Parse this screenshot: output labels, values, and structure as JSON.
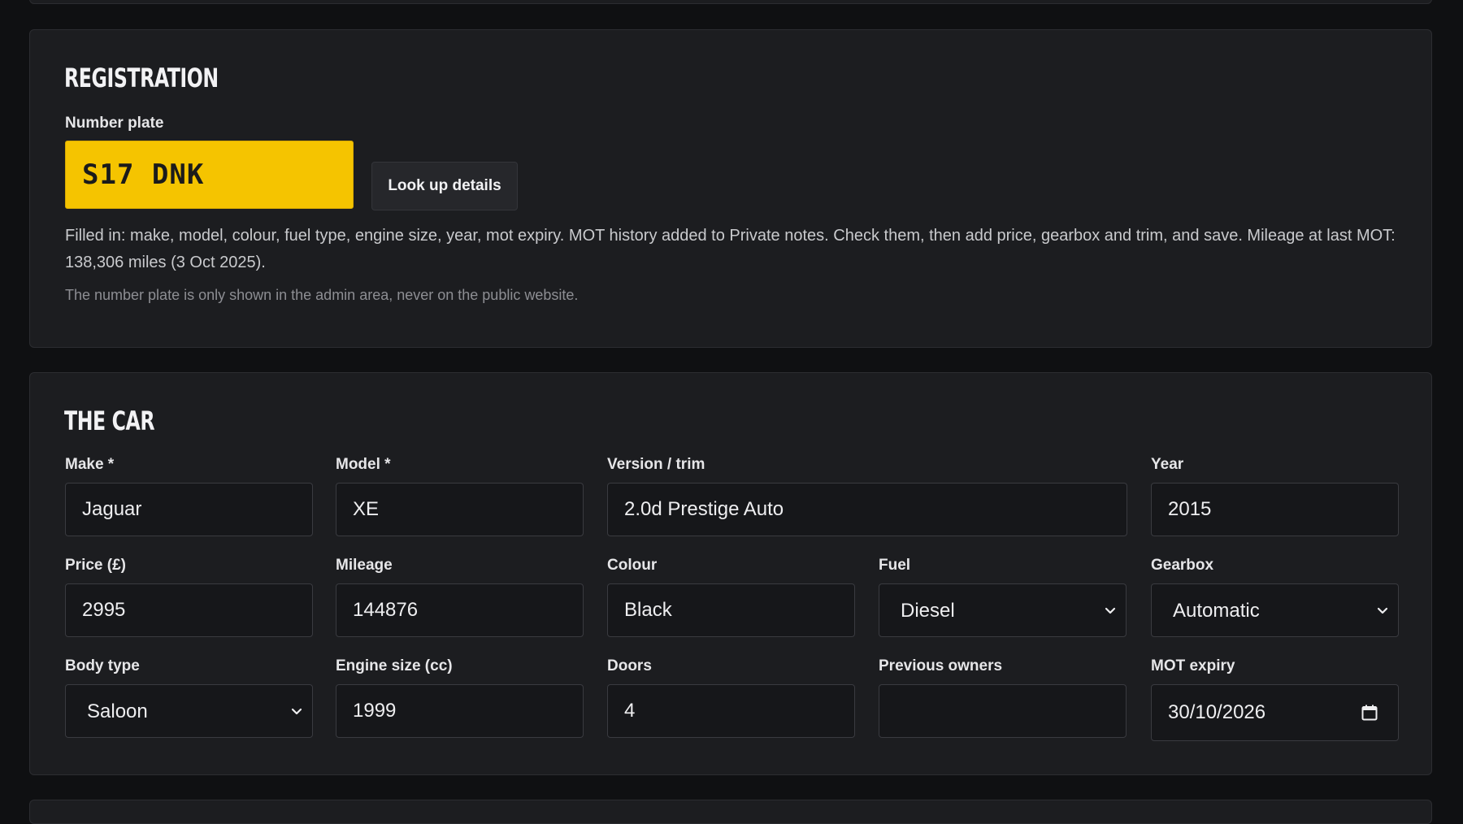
{
  "registration": {
    "title": "REGISTRATION",
    "plate_label": "Number plate",
    "plate_value": "S17 DNK",
    "lookup_button": "Look up details",
    "info_text": "Filled in: make, model, colour, fuel type, engine size, year, mot expiry. MOT history added to Private notes. Check them, then add price, gearbox and trim, and save. Mileage at last MOT: 138,306 miles (3 Oct 2025).",
    "hint_text": "The number plate is only shown in the admin area, never on the public website."
  },
  "car": {
    "title": "THE CAR",
    "make": {
      "label": "Make *",
      "value": "Jaguar"
    },
    "model": {
      "label": "Model *",
      "value": "XE"
    },
    "version": {
      "label": "Version / trim",
      "value": "2.0d Prestige Auto"
    },
    "year": {
      "label": "Year",
      "value": "2015"
    },
    "price": {
      "label": "Price (£)",
      "value": "2995"
    },
    "mileage": {
      "label": "Mileage",
      "value": "144876"
    },
    "colour": {
      "label": "Colour",
      "value": "Black"
    },
    "fuel": {
      "label": "Fuel",
      "value": "Diesel"
    },
    "gearbox": {
      "label": "Gearbox",
      "value": "Automatic"
    },
    "body_type": {
      "label": "Body type",
      "value": "Saloon"
    },
    "engine_size": {
      "label": "Engine size (cc)",
      "value": "1999"
    },
    "doors": {
      "label": "Doors",
      "value": "4"
    },
    "previous_owners": {
      "label": "Previous owners",
      "value": ""
    },
    "mot_expiry": {
      "label": "MOT expiry",
      "value": "30/10/2026"
    }
  },
  "icons": {
    "select_chevron": "chevron-down-icon",
    "date_picker": "calendar-icon"
  },
  "colors": {
    "plate_yellow": "#f5c400",
    "background": "#0f1012",
    "card": "#1c1d20"
  }
}
